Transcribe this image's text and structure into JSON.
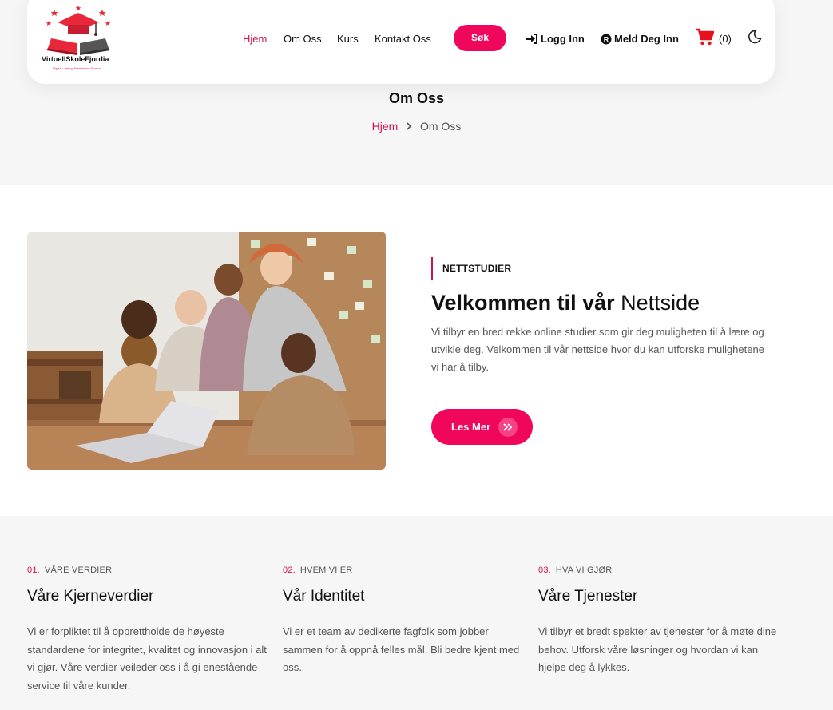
{
  "brand": {
    "name": "VirtuellSkoleFjordia",
    "tagline": "Digital Læring, Fremtidens Format"
  },
  "nav": {
    "links": [
      "Hjem",
      "Om Oss",
      "Kurs",
      "Kontakt Oss"
    ],
    "active": "Hjem",
    "search_label": "Søk",
    "login_label": "Logg Inn",
    "register_label": "Meld Deg Inn",
    "cart_count": "(0)"
  },
  "header": {
    "title": "Om Oss",
    "breadcrumb_home": "Hjem",
    "breadcrumb_current": "Om Oss"
  },
  "hero": {
    "tag": "NETTSTUDIER",
    "title_bold": "Velkommen til vår",
    "title_light": "Nettside",
    "description": "Vi tilbyr en bred rekke online studier som gir deg muligheten til å lære og utvikle deg. Velkommen til vår nettside hvor du kan utforske mulighetene vi har å tilby.",
    "button_label": "Les Mer"
  },
  "values": [
    {
      "num": "01.",
      "kicker": "VÅRE VERDIER",
      "title": "Våre Kjerneverdier",
      "text": "Vi er forpliktet til å opprettholde de høyeste standardene for integritet, kvalitet og innovasjon i alt vi gjør. Våre verdier veileder oss i å gi enestående service til våre kunder."
    },
    {
      "num": "02.",
      "kicker": "HVEM VI ER",
      "title": "Vår Identitet",
      "text": "Vi er et team av dedikerte fagfolk som jobber sammen for å oppnå felles mål. Bli bedre kjent med oss."
    },
    {
      "num": "03.",
      "kicker": "HVA VI GJØR",
      "title": "Våre Tjenester",
      "text": "Vi tilbyr et bredt spekter av tjenester for å møte dine behov. Utforsk våre løsninger og hvordan vi kan hjelpe deg å lykkes."
    }
  ],
  "colors": {
    "accent": "#f0065a",
    "active_link": "#d90d55",
    "cart": "#e8101c"
  },
  "icons": [
    "sign-in-icon",
    "register-icon",
    "cart-icon",
    "moon-icon",
    "chevron-right-icon",
    "double-chevron-right-icon"
  ]
}
